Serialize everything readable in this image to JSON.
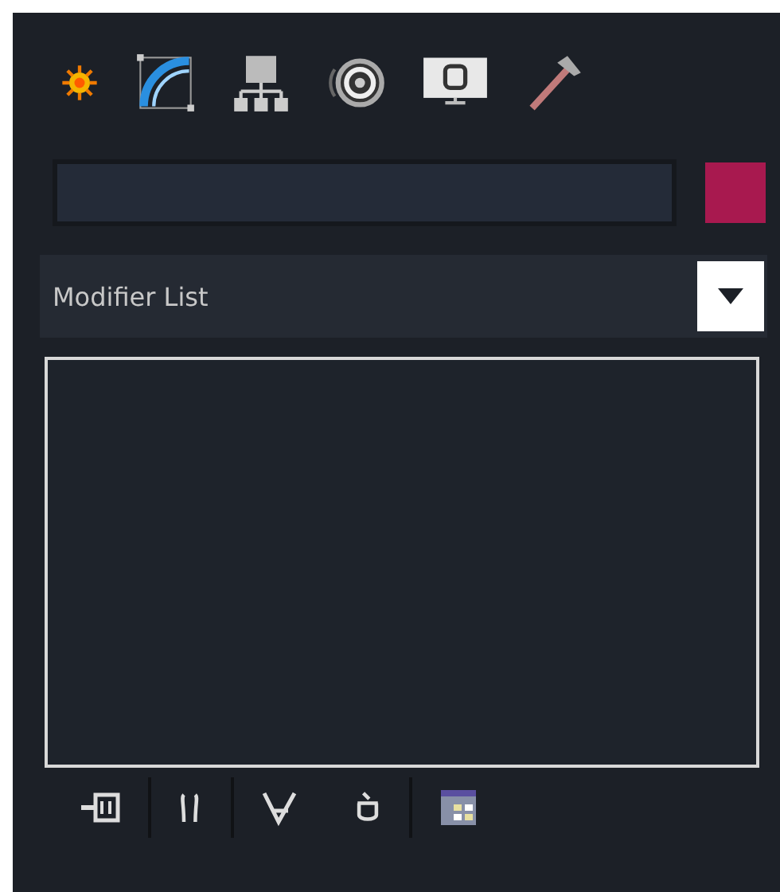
{
  "tabs": [
    {
      "kind": "create"
    },
    {
      "kind": "modify"
    },
    {
      "kind": "hierarchy"
    },
    {
      "kind": "motion"
    },
    {
      "kind": "display"
    },
    {
      "kind": "utilities"
    }
  ],
  "object": {
    "color": "#a8194f"
  },
  "modifier_list": {
    "label": "Modifier List"
  },
  "stack_tools": [
    {
      "kind": "pin"
    },
    {
      "kind": "show-end"
    },
    {
      "kind": "unique"
    },
    {
      "kind": "remove"
    },
    {
      "kind": "configure"
    }
  ]
}
